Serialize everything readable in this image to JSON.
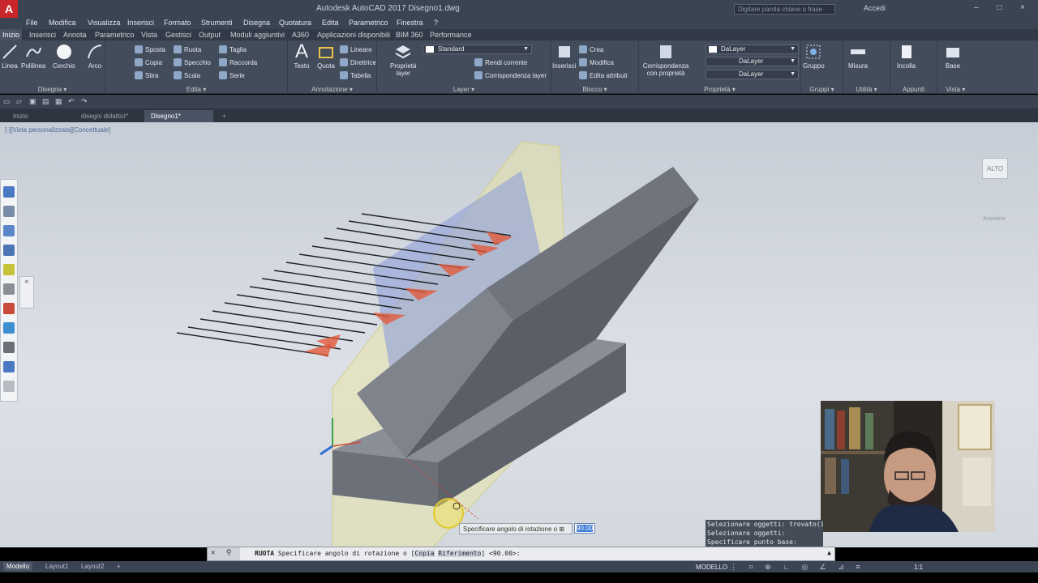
{
  "titlebar": {
    "logo": "A",
    "title": "Autodesk AutoCAD 2017   Disegno1.dwg",
    "search_placeholder": "Digitare parola chiave o frase",
    "signin": "Accedi",
    "window_buttons": "– □ ×"
  },
  "menubar": [
    "File",
    "Modifica",
    "Visualizza",
    "Inserisci",
    "Formato",
    "Strumenti",
    "Disegna",
    "Quotatura",
    "Edita",
    "Parametrico",
    "Finestra",
    "?"
  ],
  "ribbon_tabs": [
    "Inizio",
    "Inserisci",
    "Annota",
    "Parametrico",
    "Vista",
    "Gestisci",
    "Output",
    "Moduli aggiuntivi",
    "A360",
    "Applicazioni disponibili",
    "BIM 360",
    "Performance"
  ],
  "ribbon": {
    "disegna": {
      "title": "Disegna ▾",
      "linea": "Linea",
      "polilinea": "Polilinea",
      "cerchio": "Cerchio",
      "arco": "Arco"
    },
    "edita": {
      "title": "Edita ▾",
      "sposta": "Sposta",
      "ruota": "Ruota",
      "taglia": "Taglia",
      "copia": "Copia",
      "specchio": "Specchio",
      "raccorda": "Raccorda",
      "stira": "Stira",
      "scala": "Scala",
      "serie": "Serie"
    },
    "annotazione": {
      "title": "Annotazione ▾",
      "testo": "Testo",
      "quota": "Quota",
      "lineare": "Lineare",
      "direttrice": "Direttrice",
      "tabella": "Tabella"
    },
    "layer": {
      "title": "Layer ▾",
      "proprieta_layer_1": "Proprietà",
      "proprieta_layer_2": "layer",
      "layer_dropdown": "Standard",
      "rendi_corrente": "Rendi corrente",
      "corrispondenza_layer": "Corrispondenza layer"
    },
    "blocco": {
      "title": "Blocco ▾",
      "inserisci": "Inserisci",
      "crea": "Crea",
      "modifica": "Modifica",
      "edita_attributi": "Edita attributi"
    },
    "proprieta": {
      "title": "Proprietà ▾",
      "corrispondenza_1": "Corrispondenza",
      "corrispondenza_2": "con proprietà",
      "color": "DaLayer",
      "linetype": "DaLayer",
      "lineweight": "DaLayer"
    },
    "gruppi": {
      "title": "Gruppi ▾",
      "gruppo": "Gruppo"
    },
    "utilita": {
      "title": "Utilità ▾",
      "misura": "Misura"
    },
    "appunti": {
      "title": "Appunti",
      "incolla": "Incolla"
    },
    "vista": {
      "title": "Vista ▾",
      "base": "Base"
    }
  },
  "file_tabs": [
    "Inizio",
    "disegni didattici*",
    "Disegno1*",
    "+"
  ],
  "viewport": {
    "label": "[-][Vista personalizzata][Concettuale]",
    "viewcube_face": "ALTO",
    "compass_label": "Anonimo"
  },
  "history": [
    "Selezionare oggetti: trovato(i)",
    "Selezionare oggetti:",
    "Specificare punto base:"
  ],
  "dynamic_input": {
    "prompt": "Specificare angolo di rotazione o",
    "value": "90.00"
  },
  "command_line": {
    "command": "RUOTA",
    "prompt": " Specificare angolo di rotazione o [",
    "option_1": "Copia",
    "option_2": "Riferimento",
    "suffix": "] <90.00>:"
  },
  "status_tabs": [
    "Modello",
    "Layout1",
    "Layout2",
    "+"
  ],
  "status": {
    "model": "MODELLO",
    "scale": "1:1"
  },
  "colors": {
    "accent": "#3b7bd4",
    "solid_face": "#5f636d",
    "arrow_red": "#e25a3c",
    "plane_yellow": "#e8e4a8"
  }
}
